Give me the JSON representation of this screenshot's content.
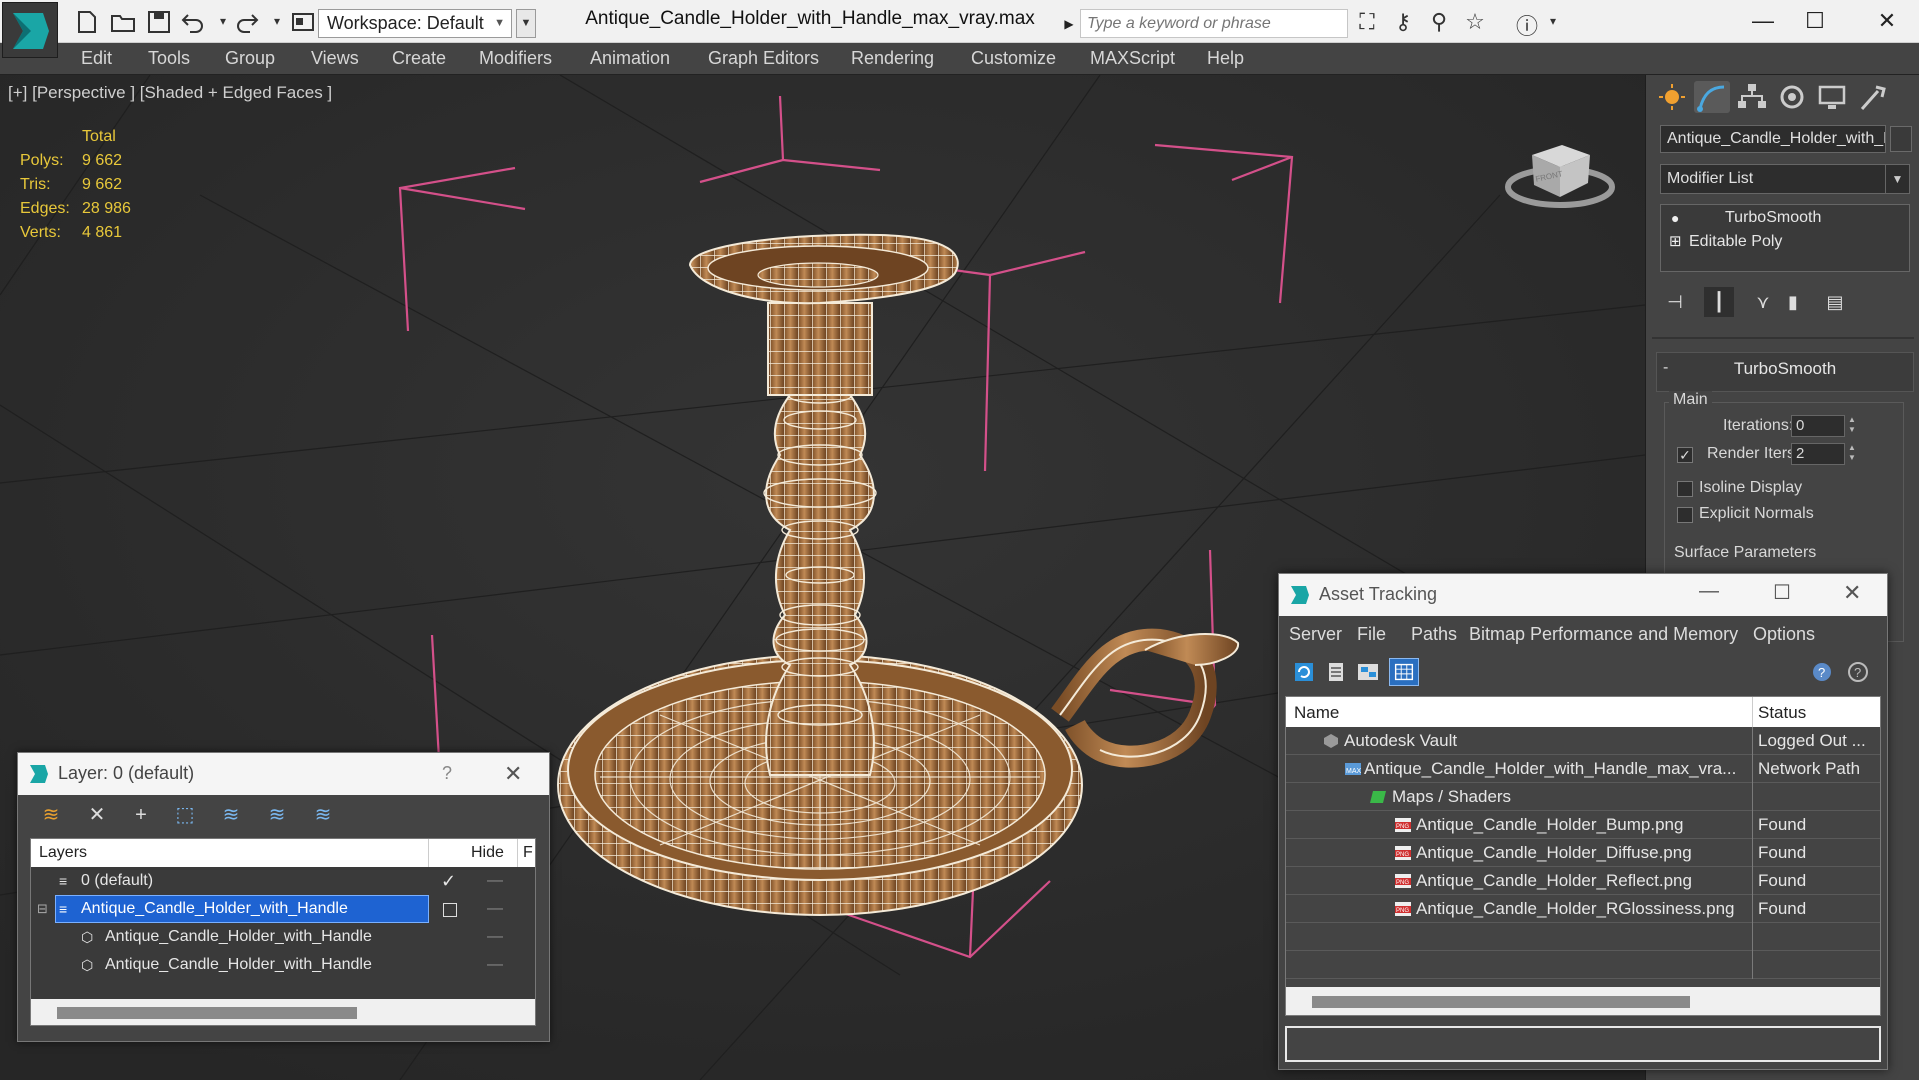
{
  "titlebar": {
    "workspace_label": "Workspace: Default",
    "window_title": "Antique_Candle_Holder_with_Handle_max_vray.max",
    "search_placeholder": "Type a keyword or phrase"
  },
  "menu": [
    "Edit",
    "Tools",
    "Group",
    "Views",
    "Create",
    "Modifiers",
    "Animation",
    "Graph Editors",
    "Rendering",
    "Customize",
    "MAXScript",
    "Help"
  ],
  "viewport": {
    "label": "[+] [Perspective ] [Shaded + Edged Faces ]",
    "stats": {
      "header": "Total",
      "rows": [
        {
          "k": "Polys:",
          "v": "9 662"
        },
        {
          "k": "Tris:",
          "v": "9 662"
        },
        {
          "k": "Edges:",
          "v": "28 986"
        },
        {
          "k": "Verts:",
          "v": "4 861"
        }
      ]
    },
    "viewcube_face": "FRONT"
  },
  "command_panel": {
    "object_name": "Antique_Candle_Holder_with_Handle",
    "modifier_list": "Modifier List",
    "stack": [
      "TurboSmooth",
      "Editable Poly"
    ],
    "rollout_title": "TurboSmooth",
    "main_group": "Main",
    "iterations_label": "Iterations:",
    "iterations_value": "0",
    "render_iters_label": "Render Iters:",
    "render_iters_value": "2",
    "isoline_label": "Isoline Display",
    "explicit_normals_label": "Explicit Normals",
    "surface_params_label": "Surface Parameters"
  },
  "layer_dialog": {
    "title": "Layer: 0 (default)",
    "help": "?",
    "columns": {
      "layers": "Layers",
      "hide": "Hide",
      "f": "F"
    },
    "rows": [
      {
        "name": "0 (default)",
        "indent": 0
      },
      {
        "name": "Antique_Candle_Holder_with_Handle",
        "indent": 0,
        "selected": true
      },
      {
        "name": "Antique_Candle_Holder_with_Handle",
        "indent": 1
      },
      {
        "name": "Antique_Candle_Holder_with_Handle",
        "indent": 1
      }
    ],
    "selection_color": "#1e63d2"
  },
  "asset_dialog": {
    "title": "Asset Tracking",
    "menu": [
      "Server",
      "File",
      "Paths",
      "Bitmap Performance and Memory",
      "Options"
    ],
    "columns": {
      "name": "Name",
      "status": "Status"
    },
    "rows": [
      {
        "name": "Autodesk Vault",
        "status": "Logged Out ...",
        "level": 0,
        "icon": "vault-icon"
      },
      {
        "name": "Antique_Candle_Holder_with_Handle_max_vra...",
        "status": "Network Path",
        "level": 1,
        "icon": "max-file-icon"
      },
      {
        "name": "Maps / Shaders",
        "status": "",
        "level": 2,
        "icon": "maps-icon"
      },
      {
        "name": "Antique_Candle_Holder_Bump.png",
        "status": "Found",
        "level": 3,
        "icon": "png-icon"
      },
      {
        "name": "Antique_Candle_Holder_Diffuse.png",
        "status": "Found",
        "level": 3,
        "icon": "png-icon"
      },
      {
        "name": "Antique_Candle_Holder_Reflect.png",
        "status": "Found",
        "level": 3,
        "icon": "png-icon"
      },
      {
        "name": "Antique_Candle_Holder_RGlossiness.png",
        "status": "Found",
        "level": 3,
        "icon": "png-icon"
      }
    ]
  },
  "colors": {
    "stats_yellow": "#e8c83a",
    "wire_pink": "#d4508a",
    "wood": "#9c6a3c",
    "selection_blue": "#1e63d2"
  }
}
